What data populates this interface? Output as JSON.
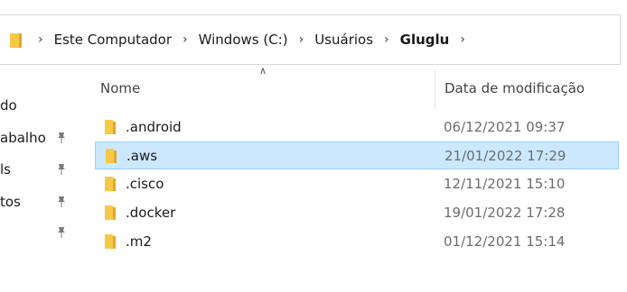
{
  "addressbar": {
    "folder_icon": "folder-icon",
    "crumbs": [
      "Este Computador",
      "Windows (C:)",
      "Usuários",
      "Gluglu"
    ]
  },
  "navpane": {
    "items": [
      "do",
      "abalho",
      "ls",
      "tos"
    ]
  },
  "columns": {
    "name": "Nome",
    "date": "Data de modificação"
  },
  "files": [
    {
      "name": ".android",
      "date": "06/12/2021 09:37"
    },
    {
      "name": ".aws",
      "date": "21/01/2022 17:29"
    },
    {
      "name": ".cisco",
      "date": "12/11/2021 15:10"
    },
    {
      "name": ".docker",
      "date": "19/01/2022 17:28"
    },
    {
      "name": ".m2",
      "date": "01/12/2021 15:14"
    }
  ],
  "colors": {
    "selection_bg": "#cce8ff",
    "selection_border": "#99d1ff",
    "folder": "#f7c948"
  }
}
